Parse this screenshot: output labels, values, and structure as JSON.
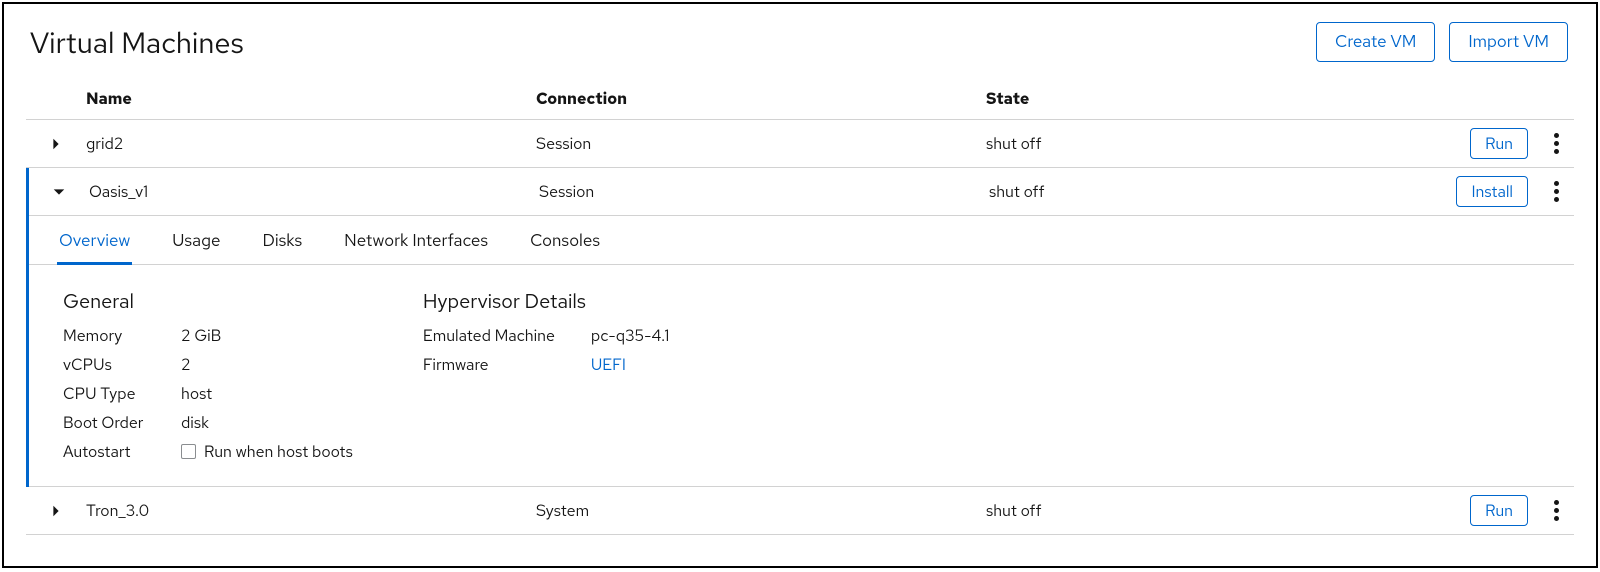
{
  "header": {
    "title": "Virtual Machines",
    "create_label": "Create VM",
    "import_label": "Import VM"
  },
  "columns": {
    "name": "Name",
    "connection": "Connection",
    "state": "State"
  },
  "rows": [
    {
      "name": "grid2",
      "connection": "Session",
      "state": "shut off",
      "action": "Run",
      "expanded": false
    },
    {
      "name": "Oasis_v1",
      "connection": "Session",
      "state": "shut off",
      "action": "Install",
      "expanded": true
    },
    {
      "name": "Tron_3.0",
      "connection": "System",
      "state": "shut off",
      "action": "Run",
      "expanded": false
    }
  ],
  "tabs": [
    "Overview",
    "Usage",
    "Disks",
    "Network Interfaces",
    "Consoles"
  ],
  "active_tab": "Overview",
  "overview": {
    "general_title": "General",
    "memory_label": "Memory",
    "memory_value": "2 GiB",
    "vcpus_label": "vCPUs",
    "vcpus_value": "2",
    "cpu_type_label": "CPU Type",
    "cpu_type_value": "host",
    "boot_order_label": "Boot Order",
    "boot_order_value": "disk",
    "autostart_label": "Autostart",
    "autostart_caption": "Run when host boots",
    "hypervisor_title": "Hypervisor Details",
    "emulated_label": "Emulated Machine",
    "emulated_value": "pc-q35-4.1",
    "firmware_label": "Firmware",
    "firmware_value": "UEFI"
  }
}
